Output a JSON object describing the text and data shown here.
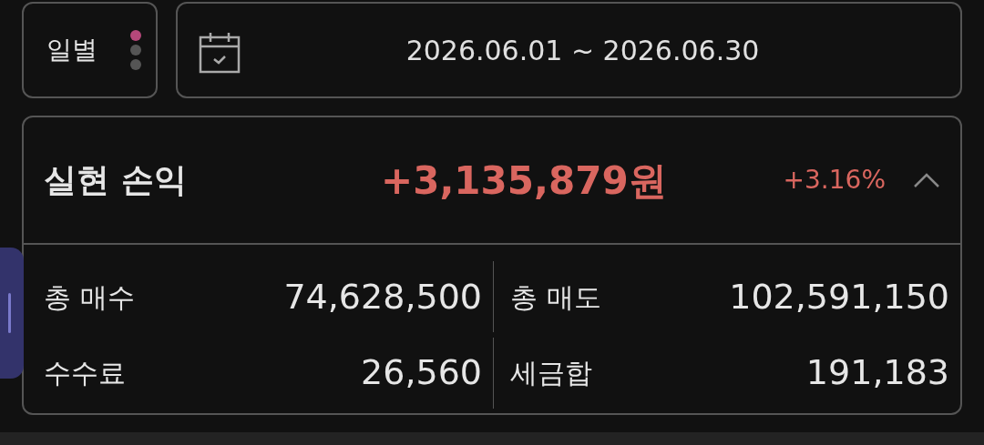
{
  "period": {
    "label": "일별",
    "dots": [
      {
        "selected": true
      },
      {
        "selected": false
      },
      {
        "selected": false
      }
    ]
  },
  "date_range": {
    "value": "2026.06.01 ~ 2026.06.30"
  },
  "summary": {
    "title": "실현 손익",
    "amount": "+3,135,879원",
    "rate": "+3.16%",
    "expanded": true,
    "stats": [
      {
        "label": "총 매수",
        "value": "74,628,500"
      },
      {
        "label": "총 매도",
        "value": "102,591,150"
      },
      {
        "label": "수수료",
        "value": "26,560"
      },
      {
        "label": "세금합",
        "value": "191,183"
      }
    ]
  }
}
